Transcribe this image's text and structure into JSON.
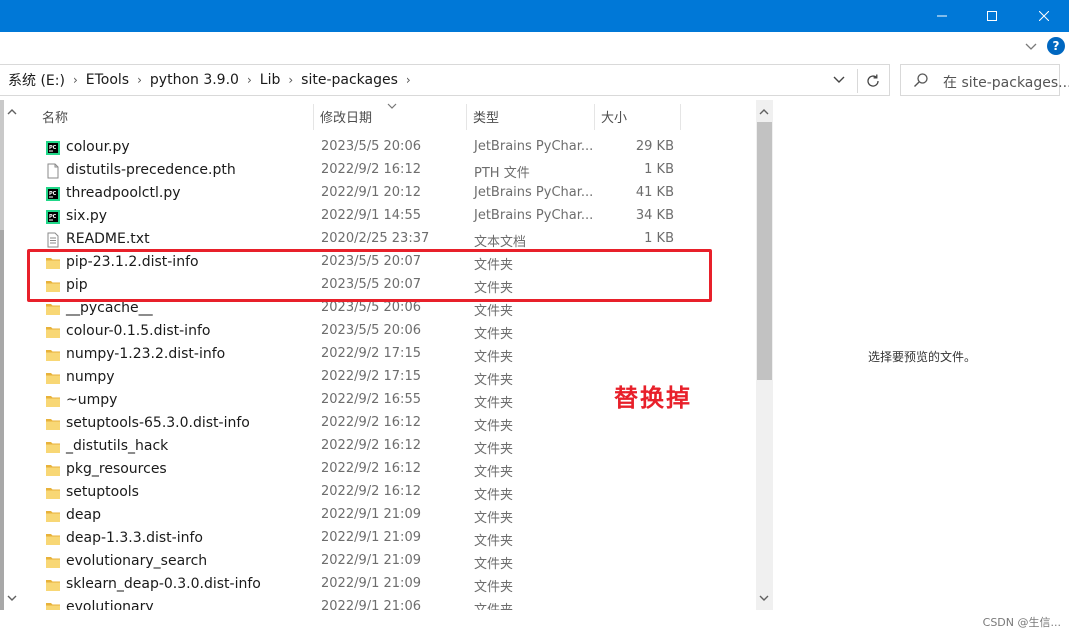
{
  "window": {
    "minimize": "—",
    "maximize": "☐",
    "close": "✕"
  },
  "ribbon": {
    "help": "?"
  },
  "breadcrumb": {
    "items": [
      "系统 (E:)",
      "ETools",
      "python 3.9.0",
      "Lib",
      "site-packages"
    ]
  },
  "search": {
    "placeholder": "在 site-packages..."
  },
  "columns": {
    "name": "名称",
    "date": "修改日期",
    "type": "类型",
    "size": "大小"
  },
  "files": [
    {
      "icon": "pycharm-file-icon",
      "name": "colour.py",
      "date": "2023/5/5 20:06",
      "type": "JetBrains PyChar...",
      "size": "29 KB"
    },
    {
      "icon": "blank-file-icon",
      "name": "distutils-precedence.pth",
      "date": "2022/9/2 16:12",
      "type": "PTH 文件",
      "size": "1 KB"
    },
    {
      "icon": "pycharm-file-icon",
      "name": "threadpoolctl.py",
      "date": "2022/9/1 20:12",
      "type": "JetBrains PyChar...",
      "size": "41 KB"
    },
    {
      "icon": "pycharm-file-icon",
      "name": "six.py",
      "date": "2022/9/1 14:55",
      "type": "JetBrains PyChar...",
      "size": "34 KB"
    },
    {
      "icon": "text-file-icon",
      "name": "README.txt",
      "date": "2020/2/25 23:37",
      "type": "文本文档",
      "size": "1 KB"
    },
    {
      "icon": "folder-icon",
      "name": "pip-23.1.2.dist-info",
      "date": "2023/5/5 20:07",
      "type": "文件夹",
      "size": ""
    },
    {
      "icon": "folder-icon",
      "name": "pip",
      "date": "2023/5/5 20:07",
      "type": "文件夹",
      "size": ""
    },
    {
      "icon": "folder-icon",
      "name": "__pycache__",
      "date": "2023/5/5 20:06",
      "type": "文件夹",
      "size": ""
    },
    {
      "icon": "folder-icon",
      "name": "colour-0.1.5.dist-info",
      "date": "2023/5/5 20:06",
      "type": "文件夹",
      "size": ""
    },
    {
      "icon": "folder-icon",
      "name": "numpy-1.23.2.dist-info",
      "date": "2022/9/2 17:15",
      "type": "文件夹",
      "size": ""
    },
    {
      "icon": "folder-icon",
      "name": "numpy",
      "date": "2022/9/2 17:15",
      "type": "文件夹",
      "size": ""
    },
    {
      "icon": "folder-icon",
      "name": "~umpy",
      "date": "2022/9/2 16:55",
      "type": "文件夹",
      "size": ""
    },
    {
      "icon": "folder-icon",
      "name": "setuptools-65.3.0.dist-info",
      "date": "2022/9/2 16:12",
      "type": "文件夹",
      "size": ""
    },
    {
      "icon": "folder-icon",
      "name": "_distutils_hack",
      "date": "2022/9/2 16:12",
      "type": "文件夹",
      "size": ""
    },
    {
      "icon": "folder-icon",
      "name": "pkg_resources",
      "date": "2022/9/2 16:12",
      "type": "文件夹",
      "size": ""
    },
    {
      "icon": "folder-icon",
      "name": "setuptools",
      "date": "2022/9/2 16:12",
      "type": "文件夹",
      "size": ""
    },
    {
      "icon": "folder-icon",
      "name": "deap",
      "date": "2022/9/1 21:09",
      "type": "文件夹",
      "size": ""
    },
    {
      "icon": "folder-icon",
      "name": "deap-1.3.3.dist-info",
      "date": "2022/9/1 21:09",
      "type": "文件夹",
      "size": ""
    },
    {
      "icon": "folder-icon",
      "name": "evolutionary_search",
      "date": "2022/9/1 21:09",
      "type": "文件夹",
      "size": ""
    },
    {
      "icon": "folder-icon",
      "name": "sklearn_deap-0.3.0.dist-info",
      "date": "2022/9/1 21:09",
      "type": "文件夹",
      "size": ""
    },
    {
      "icon": "folder-icon",
      "name": "evolutionary",
      "date": "2022/9/1 21:06",
      "type": "文件夹",
      "size": ""
    }
  ],
  "preview": {
    "message": "选择要预览的文件。"
  },
  "annotation": {
    "text": "替换掉",
    "color": "#e8202a"
  },
  "watermark": "CSDN @生信..."
}
